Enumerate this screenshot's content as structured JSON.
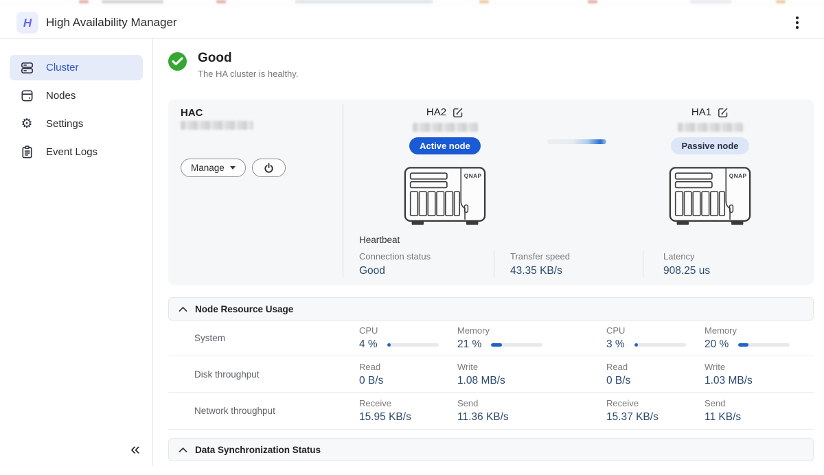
{
  "app": {
    "title": "High Availability Manager"
  },
  "sidebar": {
    "items": [
      {
        "label": "Cluster",
        "active": true
      },
      {
        "label": "Nodes",
        "active": false
      },
      {
        "label": "Settings",
        "active": false
      },
      {
        "label": "Event Logs",
        "active": false
      }
    ],
    "collapse_glyph": "«"
  },
  "status": {
    "title": "Good",
    "description": "The HA cluster is healthy."
  },
  "cluster": {
    "name": "HAC",
    "manage_label": "Manage"
  },
  "nodes": [
    {
      "name": "HA2",
      "role_badge": "Active node"
    },
    {
      "name": "HA1",
      "role_badge": "Passive node"
    }
  ],
  "device_brand": "QNAP",
  "heartbeat": {
    "title": "Heartbeat",
    "metrics": [
      {
        "label": "Connection status",
        "value": "Good"
      },
      {
        "label": "Transfer speed",
        "value": "43.35 KB/s"
      },
      {
        "label": "Latency",
        "value": "908.25 us"
      }
    ]
  },
  "sections": {
    "resource_title": "Node Resource Usage",
    "sync_title": "Data Synchronization Status"
  },
  "resource_table": {
    "rows": [
      {
        "label": "System",
        "cells": [
          {
            "label": "CPU",
            "value": "4 %",
            "bar": 4
          },
          {
            "label": "Memory",
            "value": "21 %",
            "bar": 21
          },
          {
            "label": "CPU",
            "value": "3 %",
            "bar": 3
          },
          {
            "label": "Memory",
            "value": "20 %",
            "bar": 20
          }
        ]
      },
      {
        "label": "Disk throughput",
        "cells": [
          {
            "label": "Read",
            "value": "0 B/s"
          },
          {
            "label": "Write",
            "value": "1.08 MB/s"
          },
          {
            "label": "Read",
            "value": "0 B/s"
          },
          {
            "label": "Write",
            "value": "1.03 MB/s"
          }
        ]
      },
      {
        "label": "Network throughput",
        "cells": [
          {
            "label": "Receive",
            "value": "15.95 KB/s"
          },
          {
            "label": "Send",
            "value": "11.36 KB/s"
          },
          {
            "label": "Receive",
            "value": "15.37 KB/s"
          },
          {
            "label": "Send",
            "value": "11 KB/s"
          }
        ]
      }
    ]
  },
  "colors": {
    "accent_blue": "#1a5ad4",
    "status_green": "#35a733",
    "value_navy": "#2b4a6e",
    "selected_nav_bg": "#e6ebf9",
    "selected_nav_text": "#3155c5",
    "progress_fill": "#2262c6",
    "card_bg": "#f6f7f8"
  }
}
